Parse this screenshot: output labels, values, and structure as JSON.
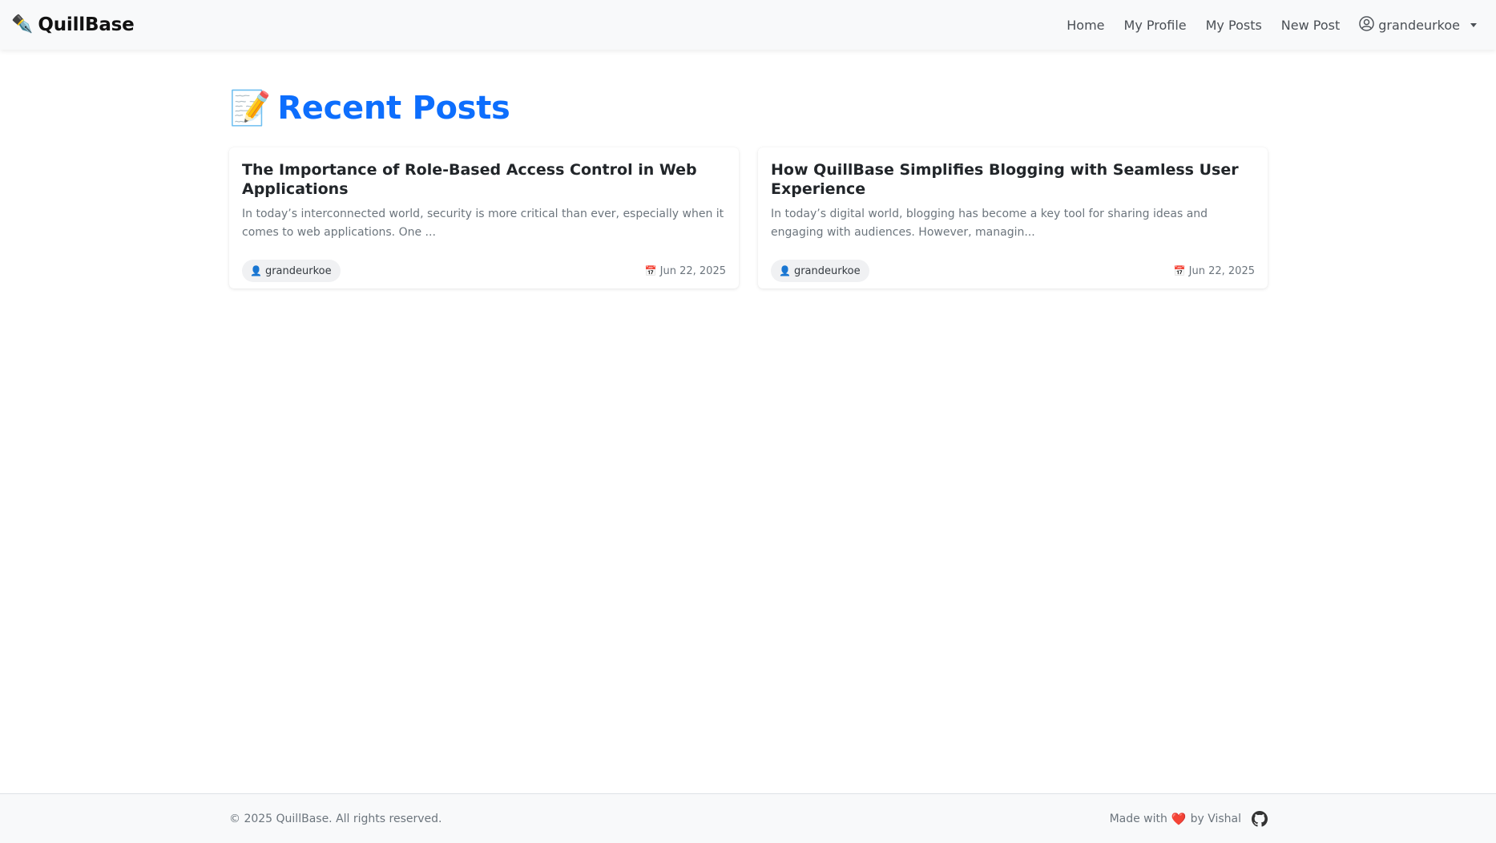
{
  "navbar": {
    "brand_icon": "✒️",
    "brand_name": "QuillBase",
    "links": [
      "Home",
      "My Profile",
      "My Posts",
      "New Post"
    ],
    "user": "grandeurkoe",
    "user_icon": "user-circle-icon"
  },
  "main": {
    "title_icon": "📝",
    "title": "Recent Posts",
    "posts": [
      {
        "title": "The Importance of Role-Based Access Control in Web Applications",
        "excerpt": "In today’s interconnected world, security is more critical than ever, especially when it comes to web applications. One ...",
        "author_icon": "👤",
        "author": "grandeurkoe",
        "date_icon": "📅",
        "date": "Jun 22, 2025"
      },
      {
        "title": "How QuillBase Simplifies Blogging with Seamless User Experience",
        "excerpt": "In today’s digital world, blogging has become a key tool for sharing ideas and engaging with audiences. However, managin...",
        "author_icon": "👤",
        "author": "grandeurkoe",
        "date_icon": "📅",
        "date": "Jun 22, 2025"
      }
    ]
  },
  "footer": {
    "copyright": "© 2025 QuillBase. All rights reserved.",
    "made_with": "Made with",
    "heart": "❤️",
    "by": "by Vishal",
    "github_icon": "github-icon"
  },
  "colors": {
    "accent": "#0d6efd",
    "navbar_bg": "#f8f9fa",
    "heart": "#e53e3e"
  }
}
